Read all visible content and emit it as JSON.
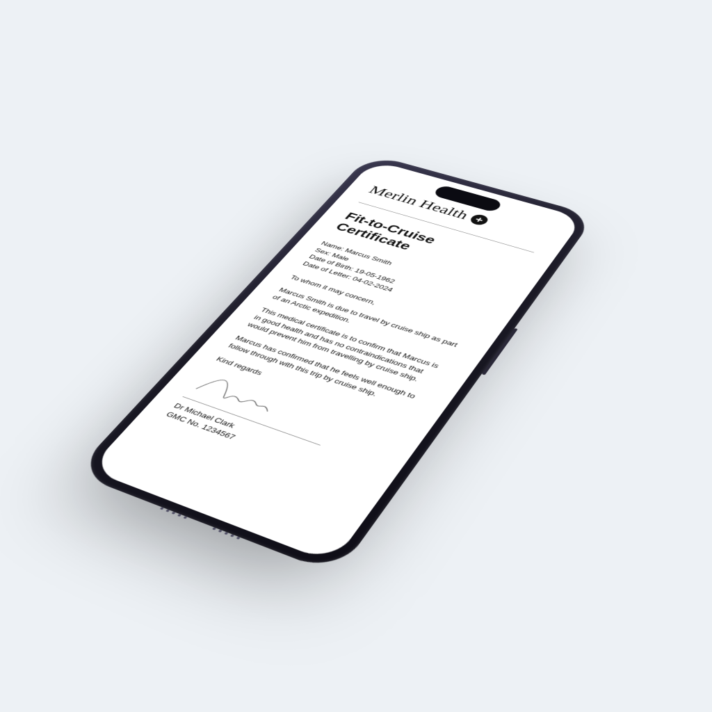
{
  "brand": {
    "name": "Merlin Health",
    "icon": "plus-icon"
  },
  "document": {
    "title": "Fit-to-Cruise Certificate",
    "meta": {
      "name_label": "Name:",
      "name_value": "Marcus Smith",
      "sex_label": "Sex:",
      "sex_value": "Male",
      "dob_label": "Date of Birth:",
      "dob_value": "19-05-1962",
      "dol_label": "Date of Letter:",
      "dol_value": "04-02-2024"
    },
    "salutation": "To whom it may concern,",
    "para1": "Marcus Smith is due to travel by cruise ship as part of an Arctic expedition.",
    "para2": "This medical certificate is to confirm that Marcus is in good health and has no contraindications that would prevent him from travelling by cruise ship.",
    "para3": "Marcus has confirmed that he feels well enough to follow through with this trip by cruise ship.",
    "closing": "Kind regards",
    "signatory": {
      "name": "Dr Michael Clark",
      "reg_label": "GMC No.",
      "reg_value": "1234567"
    }
  }
}
